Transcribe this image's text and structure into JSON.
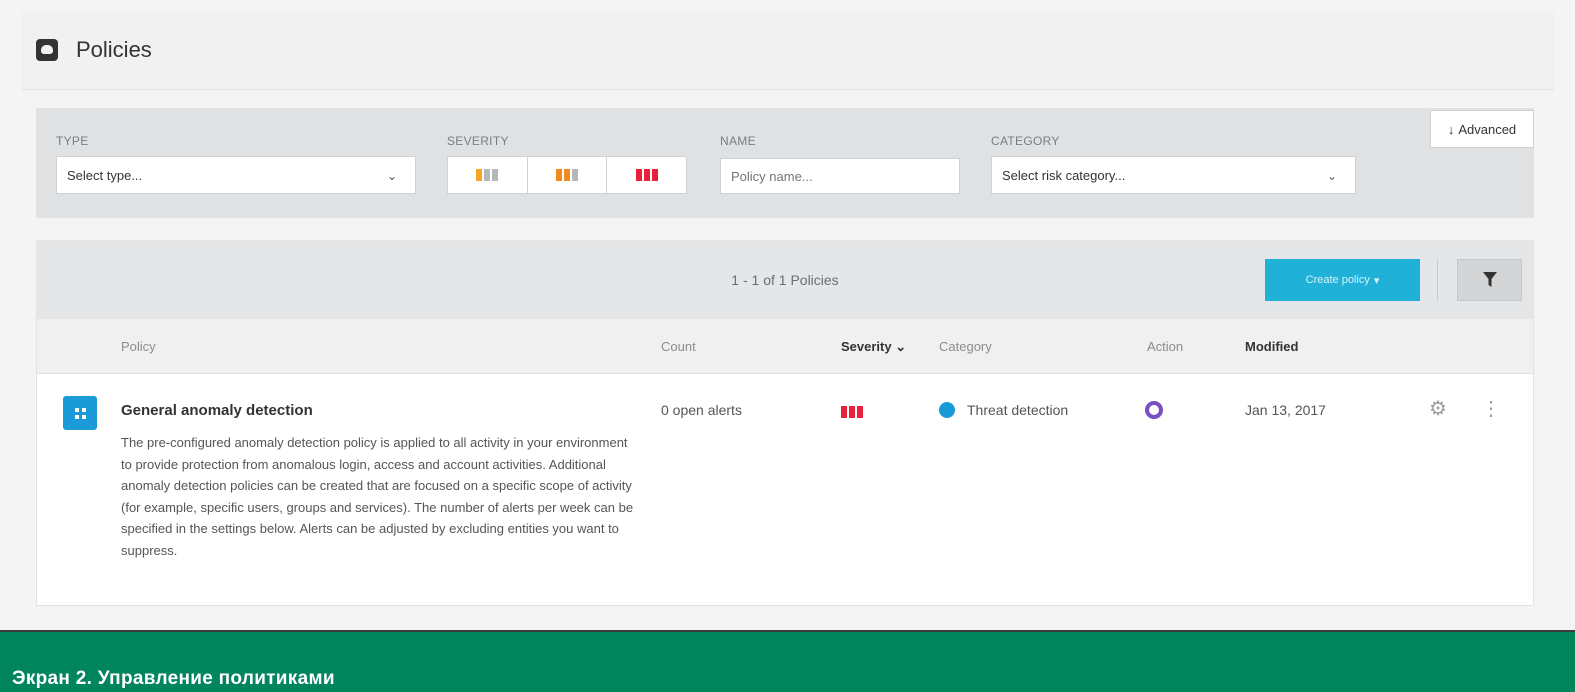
{
  "header": {
    "title": "Policies",
    "icon": "policies-icon"
  },
  "filters": {
    "type": {
      "label": "TYPE",
      "value": "Select type..."
    },
    "severity": {
      "label": "SEVERITY",
      "options": [
        {
          "name": "low",
          "colors": [
            "#f5a623",
            "#b5b8bb",
            "#b5b8bb"
          ]
        },
        {
          "name": "medium",
          "colors": [
            "#f08c1f",
            "#f08c1f",
            "#b5b8bb"
          ]
        },
        {
          "name": "high",
          "colors": [
            "#e8203a",
            "#e8203a",
            "#e8203a"
          ]
        }
      ]
    },
    "name": {
      "label": "NAME",
      "placeholder": "Policy name..."
    },
    "category": {
      "label": "CATEGORY",
      "value": "Select risk category..."
    },
    "advanced_label": "Advanced"
  },
  "toolbar": {
    "count_text": "1 - 1 of 1 Policies",
    "create_label": "Create policy",
    "accent": "#1fb1d8"
  },
  "table": {
    "columns": [
      "Policy",
      "Count",
      "Severity",
      "Category",
      "Action",
      "Modified"
    ],
    "rows": [
      {
        "title": "General anomaly detection",
        "description": "The pre-configured anomaly detection policy is applied to all activity in your environment to provide protection from anomalous login, access and account activities. Additional anomaly detection policies can be created that are focused on a specific scope of activity (for example, specific users, groups and services). The number of alerts per week can be specified in the settings below. Alerts can be adjusted by excluding entities you want to suppress.",
        "count": "0 open alerts",
        "severity": "high",
        "category": "Threat detection",
        "modified": "Jan 13, 2017"
      }
    ]
  },
  "caption": {
    "text": "Экран 2. Управление политиками",
    "color": "#00855c"
  }
}
